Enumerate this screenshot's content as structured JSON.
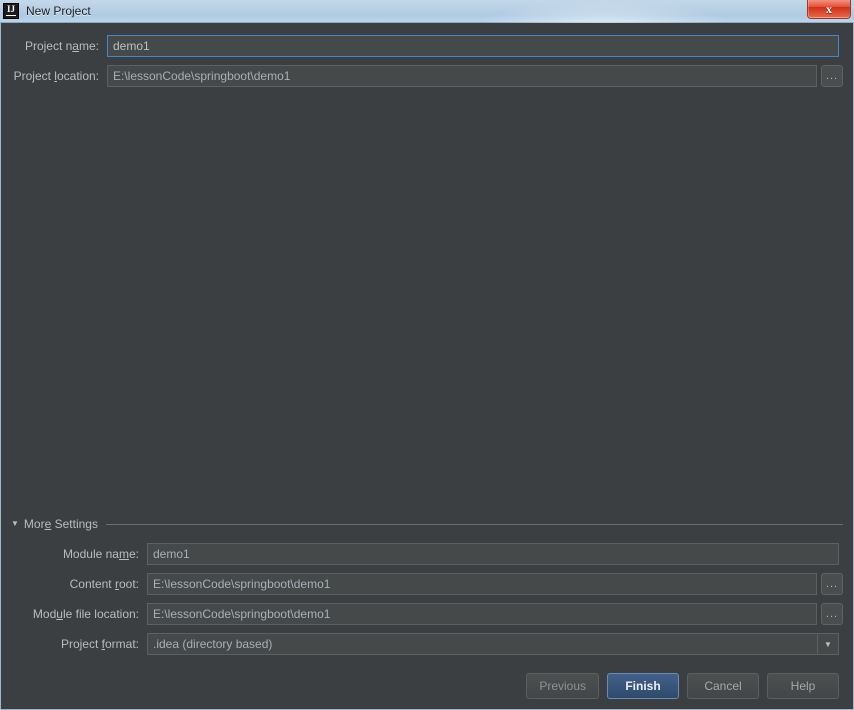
{
  "window": {
    "title": "New Project",
    "app_icon": "intellij-idea-icon",
    "icon_text": "IJ",
    "close_label": "x"
  },
  "top_section": {
    "rows": [
      {
        "label_pre": "Project n",
        "label_mn": "a",
        "label_post": "me:",
        "value": "demo1",
        "focused": true,
        "has_browse": false
      },
      {
        "label_pre": "Project ",
        "label_mn": "l",
        "label_post": "ocation:",
        "value": "E:\\lessonCode\\springboot\\demo1",
        "focused": false,
        "has_browse": true,
        "browse_label": "..."
      }
    ]
  },
  "more_settings": {
    "triangle": "▼",
    "label_pre": "Mor",
    "label_mn": "e",
    "label_post": " Settings"
  },
  "settings_section": {
    "rows": [
      {
        "label_pre": "Module na",
        "label_mn": "m",
        "label_post": "e:",
        "value": "demo1",
        "type": "text",
        "has_browse": false
      },
      {
        "label_pre": "Content ",
        "label_mn": "r",
        "label_post": "oot:",
        "value": "E:\\lessonCode\\springboot\\demo1",
        "type": "text",
        "has_browse": true,
        "browse_label": "..."
      },
      {
        "label_pre": "Mod",
        "label_mn": "u",
        "label_post": "le file location:",
        "value": "E:\\lessonCode\\springboot\\demo1",
        "type": "text",
        "has_browse": true,
        "browse_label": "..."
      },
      {
        "label_pre": "Project ",
        "label_mn": "f",
        "label_post": "ormat:",
        "value": ".idea (directory based)",
        "type": "combo",
        "arrow": "▼"
      }
    ]
  },
  "buttons": {
    "previous": "Previous",
    "finish": "Finish",
    "cancel": "Cancel",
    "help": "Help"
  },
  "colors": {
    "background": "#3c3f41",
    "field_background": "#45494a",
    "focus_border": "#4b83c8",
    "default_button": "#2f4a6b",
    "label_text": "#bbbbbb",
    "titlebar": "#b7cfe5",
    "close_button": "#cf2f16"
  }
}
